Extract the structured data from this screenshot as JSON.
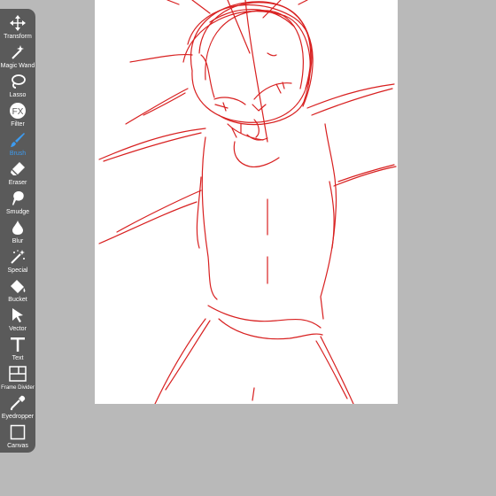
{
  "colors": {
    "workspace": "#b9b9b9",
    "canvas": "#ffffff",
    "toolbar": "#5a5a5a",
    "active_tool": "#3d9bf0",
    "sketch_stroke": "#d82020"
  },
  "toolbar": {
    "active": "Brush",
    "tools": [
      {
        "label": "Transform",
        "icon": "move-arrows-icon"
      },
      {
        "label": "Magic Wand",
        "icon": "magic-wand-icon"
      },
      {
        "label": "Lasso",
        "icon": "lasso-icon"
      },
      {
        "label": "Filter",
        "icon": "fx-icon"
      },
      {
        "label": "Brush",
        "icon": "brush-icon"
      },
      {
        "label": "Eraser",
        "icon": "eraser-icon"
      },
      {
        "label": "Smudge",
        "icon": "smudge-icon"
      },
      {
        "label": "Blur",
        "icon": "droplet-icon"
      },
      {
        "label": "Special",
        "icon": "sparkle-wand-icon"
      },
      {
        "label": "Bucket",
        "icon": "paint-bucket-icon"
      },
      {
        "label": "Vector",
        "icon": "pointer-arrow-icon"
      },
      {
        "label": "Text",
        "icon": "text-t-icon"
      },
      {
        "label": "Frame Divider",
        "icon": "frame-divider-icon"
      },
      {
        "label": "Eyedropper",
        "icon": "eyedropper-icon"
      },
      {
        "label": "Canvas",
        "icon": "canvas-square-icon"
      }
    ]
  }
}
